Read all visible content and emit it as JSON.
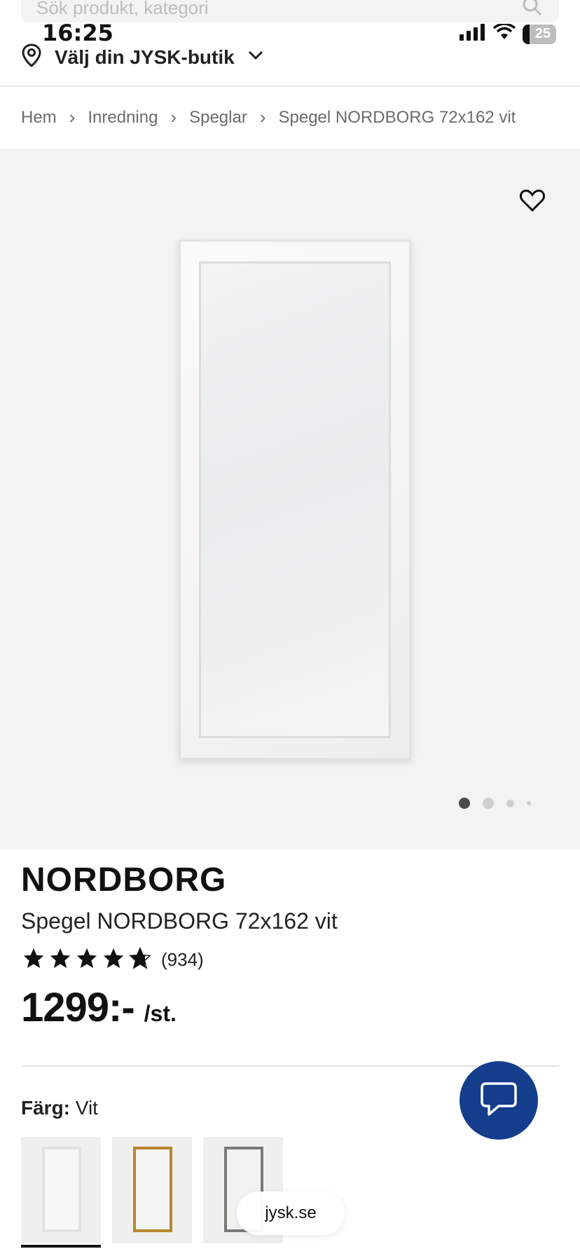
{
  "search": {
    "placeholder": "Sök produkt, kategori"
  },
  "status_bar": {
    "time": "16:25",
    "battery": "25"
  },
  "store": {
    "label": "Välj din JYSK-butik"
  },
  "breadcrumb": [
    "Hem",
    "Inredning",
    "Speglar",
    "Spegel NORDBORG 72x162 vit"
  ],
  "gallery": {
    "image_count": 4,
    "active_index": 0
  },
  "product": {
    "brand": "NORDBORG",
    "name": "Spegel NORDBORG 72x162 vit",
    "rating": 4.8,
    "review_count": "(934)",
    "price": "1299:-",
    "unit": "/st."
  },
  "color": {
    "label": "Färg:",
    "value": "Vit"
  },
  "swatches": [
    {
      "name": "Vit",
      "frame_color": "#e2e2e2",
      "active": true
    },
    {
      "name": "Guld",
      "frame_color": "#b8862e",
      "active": false
    },
    {
      "name": "Grå",
      "frame_color": "#7a7a74",
      "active": false
    }
  ],
  "footer": {
    "url": "jysk.se"
  },
  "colors": {
    "chat_button": "#143d8c",
    "gallery_bg": "#f3f3f3"
  }
}
